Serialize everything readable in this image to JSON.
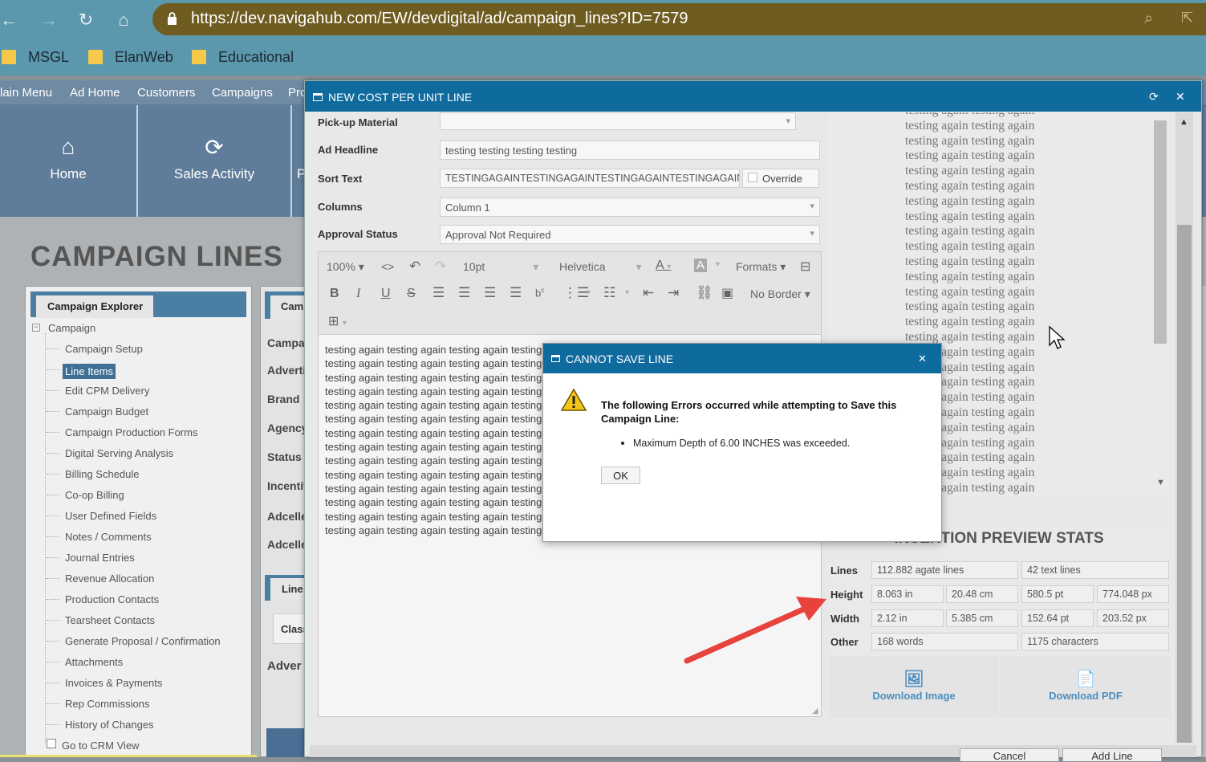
{
  "browser": {
    "url": "https://dev.navigahub.com/EW/devdigital/ad/campaign_lines?ID=7579",
    "bookmarks": [
      "MSGL",
      "ElanWeb",
      "Educational"
    ]
  },
  "app": {
    "menu": [
      "lain Menu",
      "Ad Home",
      "Customers",
      "Campaigns",
      "Pro"
    ],
    "tiles": [
      {
        "label": "Home",
        "icon": "home-icon"
      },
      {
        "label": "Sales Activity",
        "icon": "sales-activity-icon"
      },
      {
        "label": "P"
      }
    ],
    "page_title": "CAMPAIGN LINES",
    "explorer": {
      "tab": "Campaign Explorer",
      "root": "Campaign",
      "items": [
        "Campaign Setup",
        "Line Items",
        "Edit CPM Delivery",
        "Campaign Budget",
        "Campaign Production Forms",
        "Digital Serving Analysis",
        "Billing Schedule",
        "Co-op Billing",
        "User Defined Fields",
        "Notes / Comments",
        "Journal Entries",
        "Revenue Allocation",
        "Production Contacts",
        "Tearsheet Contacts",
        "Generate Proposal / Confirmation",
        "Attachments",
        "Invoices & Payments",
        "Rep Commissions",
        "History of Changes"
      ],
      "selected": "Line Items",
      "crm": "Go to CRM View"
    },
    "mid_labels": [
      "Cam",
      "Campai",
      "Adverti",
      "Brand",
      "Agency",
      "Status",
      "Incentiv",
      "Adcelle",
      "Adcelle",
      "Line",
      "Class",
      "Adver"
    ]
  },
  "modal": {
    "title": "NEW COST PER UNIT LINE",
    "fields": {
      "pickup_label": "Pick-up Material",
      "pickup_value": "",
      "headline_label": "Ad Headline",
      "headline_value": "testing testing testing testing",
      "sort_label": "Sort Text",
      "sort_value": "TESTINGAGAINTESTINGAGAINTESTINGAGAINTESTINGAGAINTE",
      "override_label": "Override",
      "columns_label": "Columns",
      "columns_value": "Column 1",
      "approval_label": "Approval Status",
      "approval_value": "Approval Not Required"
    },
    "toolbar": {
      "zoom": "100%",
      "font_size": "10pt",
      "font": "Helvetica",
      "formats": "Formats",
      "border": "No Border"
    },
    "editor_line": "testing again testing again testing again testing again testing again",
    "preview_line": "testing again testing again",
    "stats": {
      "title": "INSERTION PREVIEW STATS",
      "lines_label": "Lines",
      "lines": [
        "112.882 agate lines",
        "42 text lines"
      ],
      "height_label": "Height",
      "height": [
        "8.063 in",
        "20.48 cm",
        "580.5 pt",
        "774.048 px"
      ],
      "width_label": "Width",
      "width": [
        "2.12 in",
        "5.385 cm",
        "152.64 pt",
        "203.52 px"
      ],
      "other_label": "Other",
      "other": [
        "168 words",
        "1175 characters"
      ]
    },
    "download_image": "Download Image",
    "download_pdf": "Download PDF",
    "cancel": "Cancel",
    "add_line": "Add Line"
  },
  "error_dialog": {
    "title": "CANNOT SAVE LINE",
    "message": "The following Errors occurred while attempting to Save this Campaign Line:",
    "items": [
      "Maximum Depth of 6.00 INCHES was exceeded."
    ],
    "ok": "OK"
  },
  "colors": {
    "header_blue": "#0f6b9e",
    "url_bar": "#6f5c20",
    "chrome": "#5b97ad",
    "arrow": "#e8423c"
  }
}
